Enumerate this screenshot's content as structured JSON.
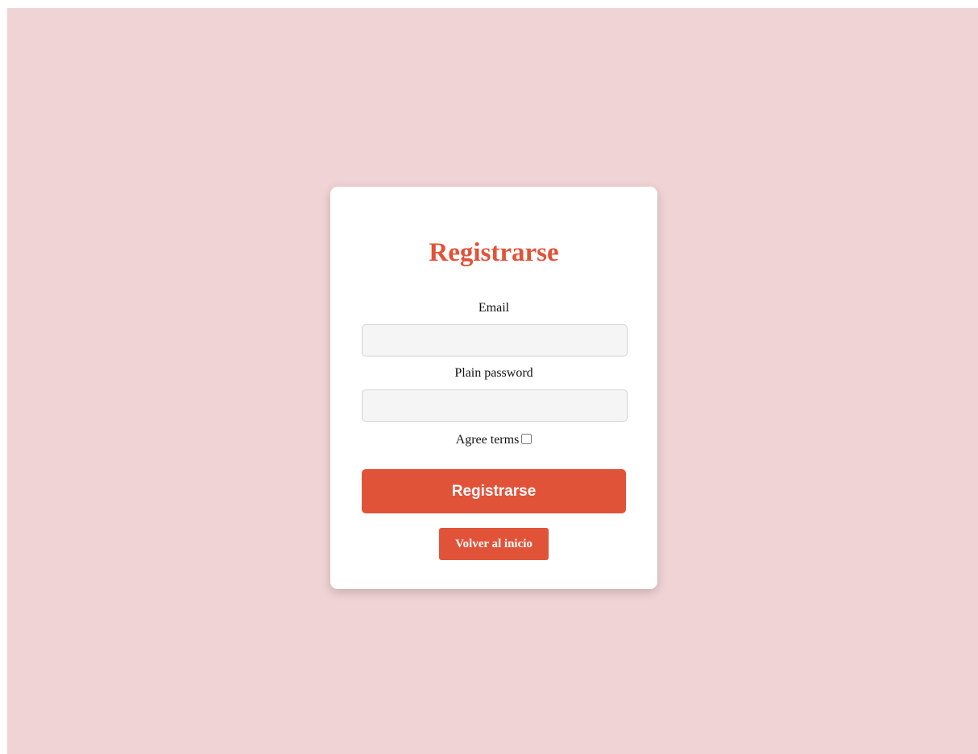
{
  "form": {
    "title": "Registrarse",
    "email_label": "Email",
    "email_value": "",
    "password_label": "Plain password",
    "password_value": "",
    "agree_label": "Agree terms",
    "agree_checked": false,
    "submit_label": "Registrarse",
    "back_label": "Volver al inicio"
  },
  "colors": {
    "background": "#f0d3d4",
    "card": "#ffffff",
    "accent": "#e15339",
    "input_bg": "#f5f5f5"
  }
}
